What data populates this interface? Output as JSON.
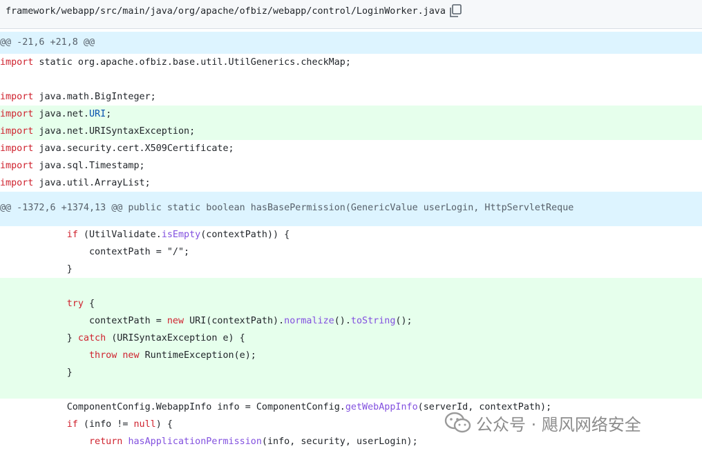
{
  "file_header": {
    "path": "framework/webapp/src/main/java/org/apache/ofbiz/webapp/control/LoginWorker.java",
    "copy_icon": "copy-icon"
  },
  "colors": {
    "hunk_bg": "#ddf4ff",
    "added_bg": "#e6ffec",
    "keyword": "#cf222e",
    "method": "#8250df",
    "class_ref": "#0550ae"
  },
  "hunks": [
    {
      "header": "@@ -21,6 +21,8 @@"
    },
    {
      "header": "@@ -1372,6 +1374,13 @@ public static boolean hasBasePermission(GenericValue userLogin, HttpServletReque"
    }
  ],
  "code": {
    "l1a": "import",
    "l1b": " static org.apache.ofbiz.base.util.UtilGenerics.checkMap;",
    "l3a": "import",
    "l3b": " java.math.BigInteger;",
    "l4a": "import",
    "l4b": " java.net.",
    "l4c": "URI",
    "l4d": ";",
    "l5a": "import",
    "l5b": " java.net.URISyntaxException;",
    "l6a": "import",
    "l6b": " java.security.cert.X509Certificate;",
    "l7a": "import",
    "l7b": " java.sql.Timestamp;",
    "l8a": "import",
    "l8b": " java.util.ArrayList;",
    "m1a": "            ",
    "m1b": "if",
    "m1c": " (UtilValidate.",
    "m1d": "isEmpty",
    "m1e": "(contextPath)) {",
    "m2a": "                contextPath = \"/\";",
    "m3a": "            }",
    "m5a": "            ",
    "m5b": "try",
    "m5c": " {",
    "m6a": "                contextPath = ",
    "m6b": "new",
    "m6c": " URI(contextPath).",
    "m6d": "normalize",
    "m6e": "().",
    "m6f": "toString",
    "m6g": "();",
    "m7a": "            } ",
    "m7b": "catch",
    "m7c": " (URISyntaxException e) {",
    "m8a": "                ",
    "m8b": "throw",
    "m8c": " ",
    "m8d": "new",
    "m8e": " RuntimeException(e);",
    "m9a": "            }",
    "m11a": "            ComponentConfig.WebappInfo info = ComponentConfig.",
    "m11b": "getWebAppInfo",
    "m11c": "(serverId, contextPath);",
    "m12a": "            ",
    "m12b": "if",
    "m12c": " (info != ",
    "m12d": "null",
    "m12e": ") {",
    "m13a": "                ",
    "m13b": "return",
    "m13c": " ",
    "m13d": "hasApplicationPermission",
    "m13e": "(info, security, userLogin);"
  },
  "watermark": {
    "icon": "wechat-icon",
    "text": "公众号 · 飓风网络安全"
  }
}
